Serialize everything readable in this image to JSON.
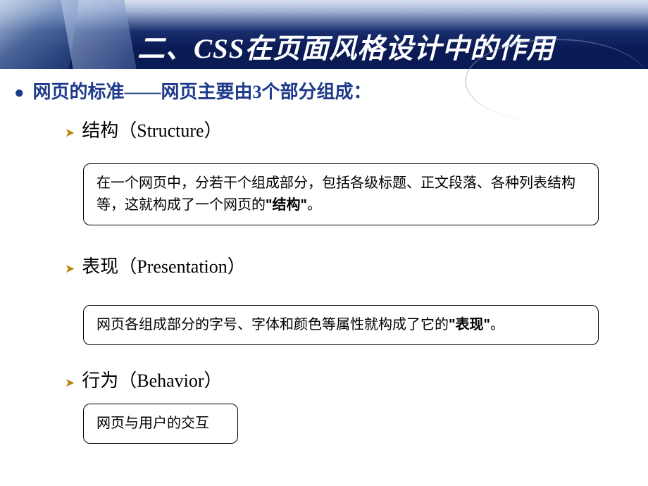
{
  "slide": {
    "title": "二、CSS在页面风格设计中的作用",
    "mainPoint": "网页的标准——网页主要由3个部分组成：",
    "sections": [
      {
        "heading": "结构（Structure）",
        "description": "在一个网页中，分若干个组成部分，包括各级标题、正文段落、各种列表结构等，这就构成了一个网页的",
        "emphasis": "\"结构\"",
        "tail": "。"
      },
      {
        "heading": "表现（Presentation）",
        "description": "网页各组成部分的字号、字体和颜色等属性就构成了它的",
        "emphasis": "\"表现\"",
        "tail": "。"
      },
      {
        "heading": "行为（Behavior）",
        "description": "网页与用户的交互",
        "emphasis": "",
        "tail": ""
      }
    ]
  }
}
